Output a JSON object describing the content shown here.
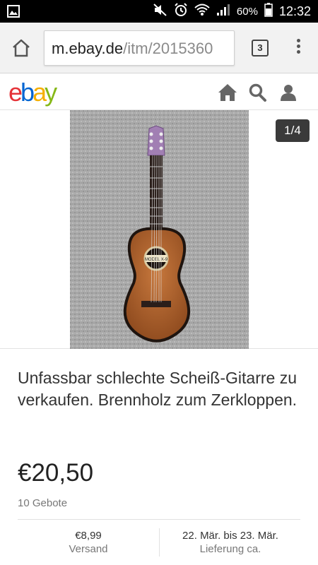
{
  "status_bar": {
    "battery_percent": "60%",
    "time": "12:32",
    "icons": [
      "image-notification-icon",
      "mute-icon",
      "alarm-icon",
      "wifi-icon",
      "signal-icon",
      "battery-icon"
    ]
  },
  "browser": {
    "url_host": "m.ebay.de",
    "url_path": "/itm/2015360",
    "tab_count": "3"
  },
  "header": {
    "logo": {
      "e": "e",
      "b": "b",
      "a": "a",
      "y": "y"
    },
    "icons": [
      "home-icon",
      "search-icon",
      "user-icon"
    ]
  },
  "gallery": {
    "counter": "1/4",
    "image_label": "MODEL X-9"
  },
  "item": {
    "title": "Unfassbar schlechte Scheiß-Gitarre zu verkaufen. Brennholz zum Zerkloppen.",
    "price": "€20,50",
    "bids": "10 Gebote",
    "shipping_cost": "€8,99",
    "shipping_label": "Versand",
    "delivery_dates": "22. Mär. bis 23. Mär.",
    "delivery_label": "Lieferung ca."
  },
  "colors": {
    "ebay_red": "#e53238",
    "ebay_blue": "#0064d2",
    "ebay_yellow": "#f5af02",
    "ebay_green": "#86b817"
  }
}
